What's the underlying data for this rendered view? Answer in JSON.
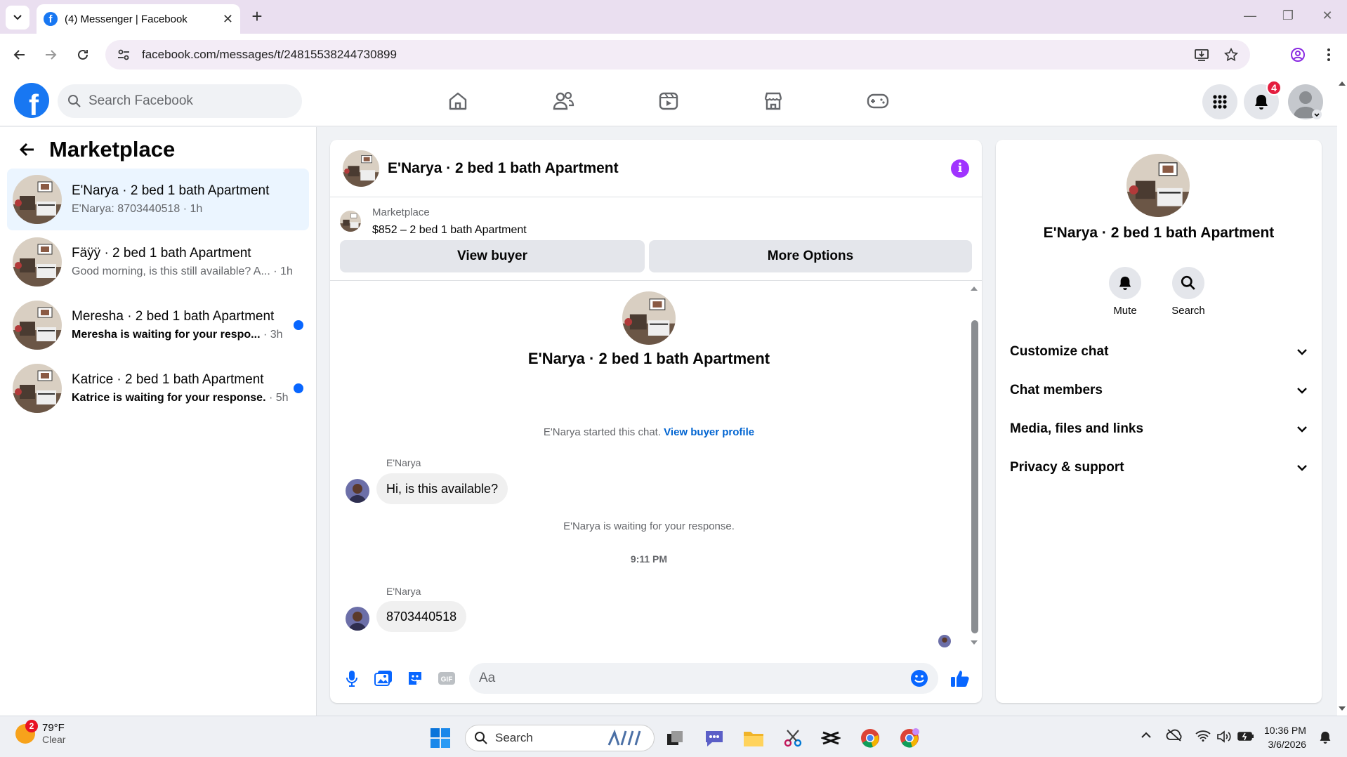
{
  "browser": {
    "tab_title": "(4) Messenger | Facebook",
    "url": "facebook.com/messages/t/24815538244730899"
  },
  "fb": {
    "search_placeholder": "Search Facebook",
    "notification_count": "4",
    "accent": "#0866ff"
  },
  "left": {
    "title": "Marketplace",
    "conversations": [
      {
        "name": "E'Narya · 2 bed 1 bath Apartment",
        "preview": "E'Narya: 8703440518",
        "time": "· 1h",
        "unread": false,
        "selected": true
      },
      {
        "name": "Fäÿÿ · 2 bed 1 bath Apartment",
        "preview": "Good morning, is this still available? A...",
        "time": "· 1h",
        "unread": false,
        "selected": false
      },
      {
        "name": "Meresha · 2 bed 1 bath Apartment",
        "preview": "Meresha is waiting for your respo...",
        "time": "· 3h",
        "unread": true,
        "selected": false
      },
      {
        "name": "Katrice · 2 bed 1 bath Apartment",
        "preview": "Katrice is waiting for your response.",
        "time": "· 5h",
        "unread": true,
        "selected": false
      }
    ]
  },
  "chat": {
    "title": "E'Narya · 2 bed 1 bath Apartment",
    "marketplace_label": "Marketplace",
    "listing": "$852 – 2 bed 1 bath Apartment",
    "view_buyer": "View buyer",
    "more_options": "More Options",
    "intro_title": "E'Narya · 2 bed 1 bath Apartment",
    "started_text": "E'Narya started this chat.",
    "view_profile": "View buyer profile",
    "messages": [
      {
        "sender": "E'Narya",
        "text": "Hi, is this available?"
      },
      {
        "sender": "E'Narya",
        "text": "8703440518"
      }
    ],
    "waiting_text": "E'Narya is waiting for your response.",
    "timestamp": "9:11 PM",
    "composer_placeholder": "Aa"
  },
  "info": {
    "title": "E'Narya · 2 bed 1 bath Apartment",
    "mute": "Mute",
    "search": "Search",
    "sections": [
      "Customize chat",
      "Chat members",
      "Media, files and links",
      "Privacy & support"
    ]
  },
  "taskbar": {
    "weather_badge": "2",
    "temp": "79°F",
    "condition": "Clear",
    "search": "Search",
    "time": "10:36 PM",
    "date": "3/6/2026"
  }
}
